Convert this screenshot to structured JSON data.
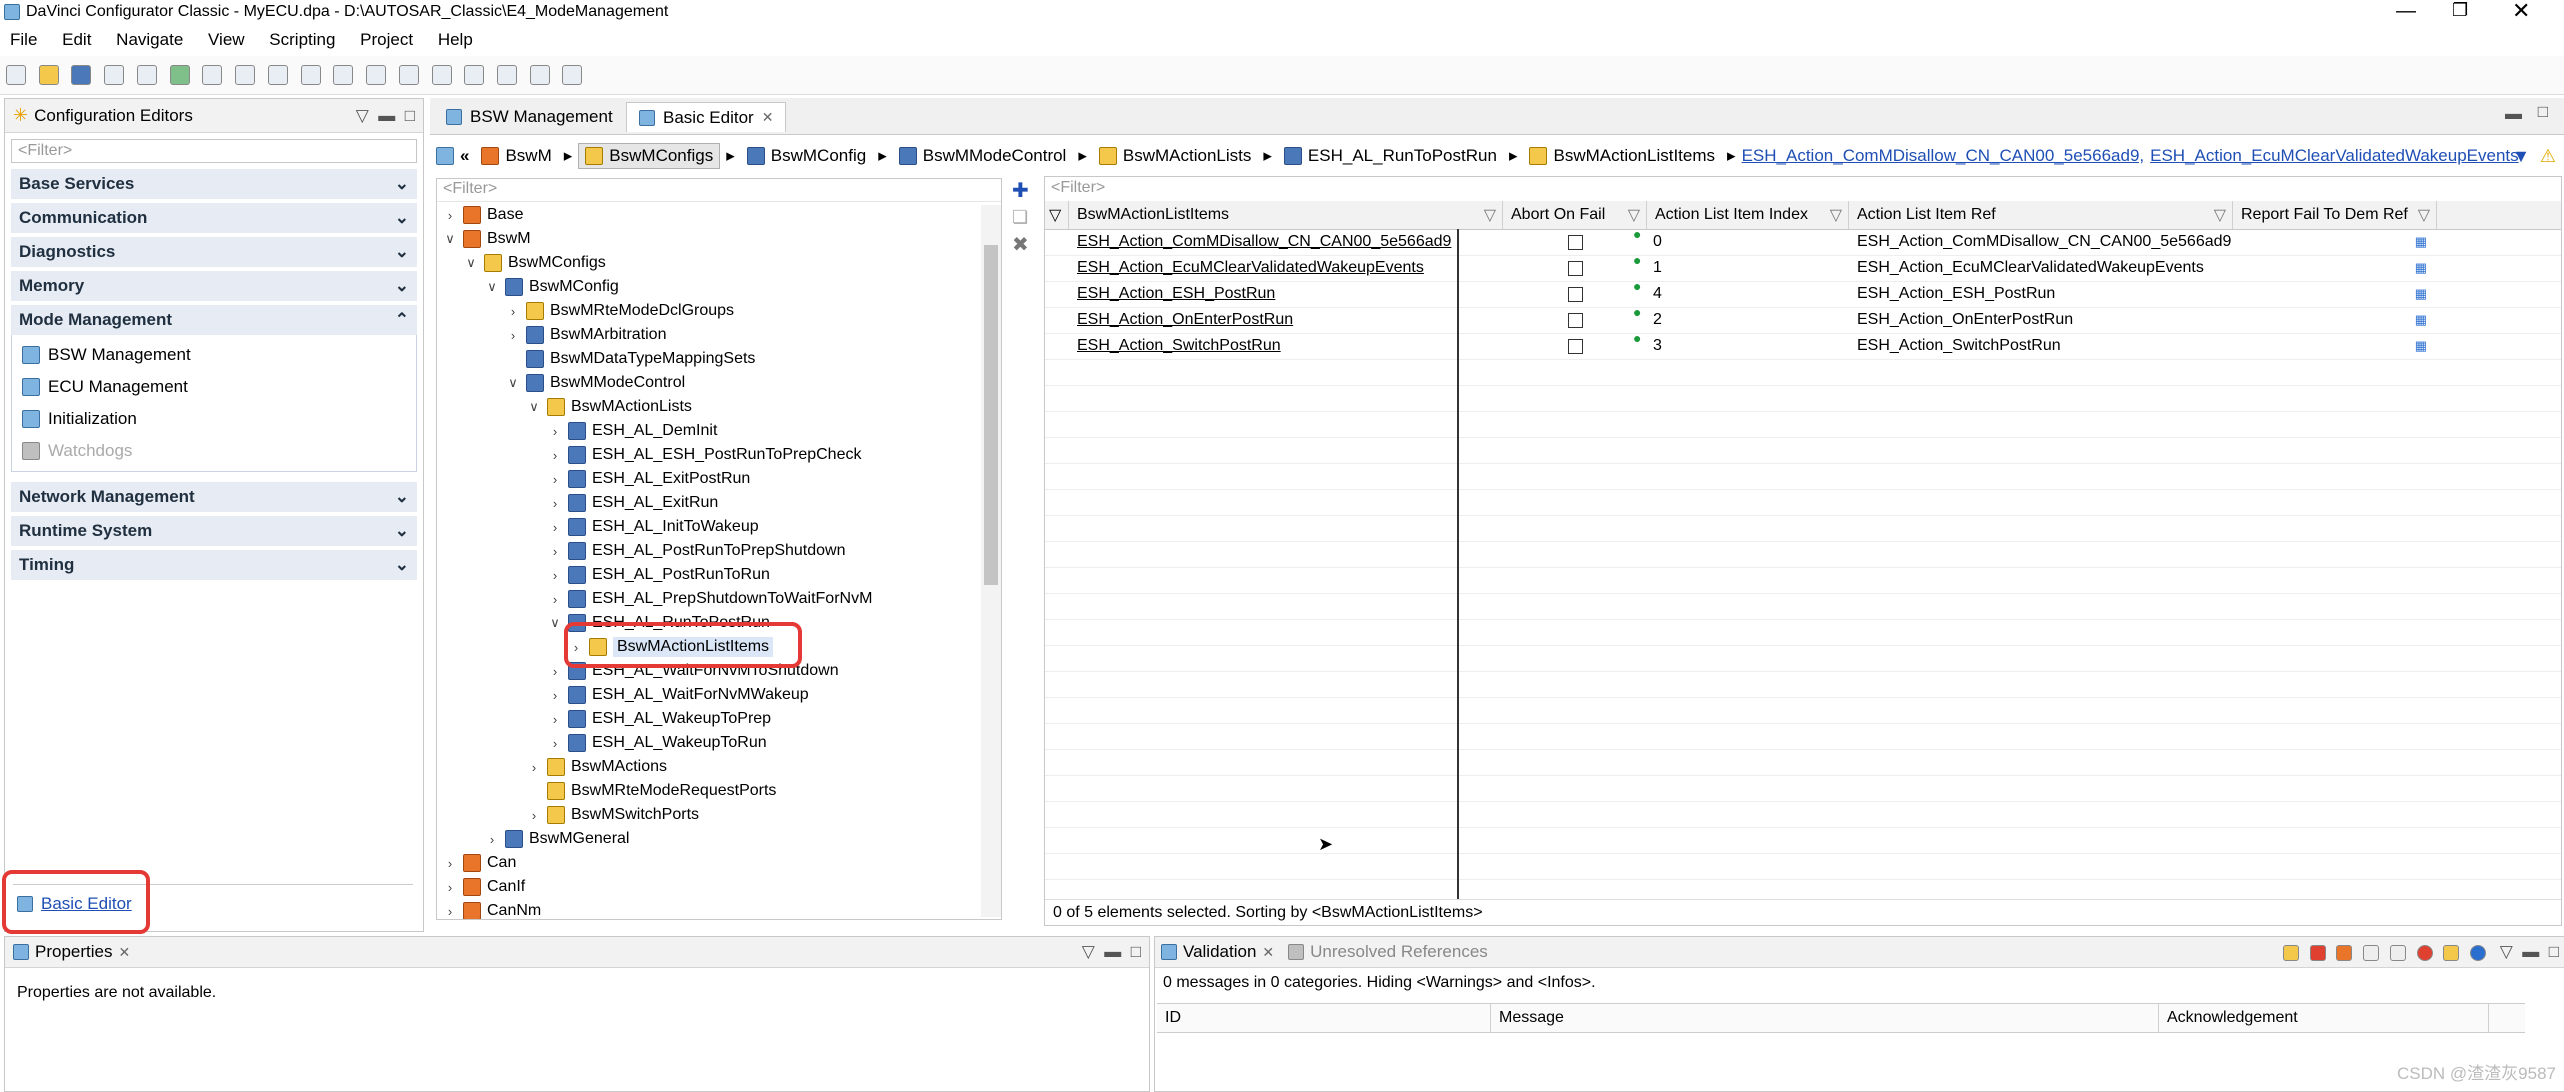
{
  "window": {
    "title": "DaVinci Configurator Classic - MyECU.dpa - D:\\AUTOSAR_Classic\\E4_ModeManagement"
  },
  "menu": [
    "File",
    "Edit",
    "Navigate",
    "View",
    "Scripting",
    "Project",
    "Help"
  ],
  "left_pane": {
    "title": "Configuration Editors",
    "filter_placeholder": "<Filter>",
    "categories": [
      {
        "label": "Base Services"
      },
      {
        "label": "Communication"
      },
      {
        "label": "Diagnostics"
      },
      {
        "label": "Memory"
      },
      {
        "label": "Mode Management",
        "expanded": true,
        "items": [
          {
            "label": "BSW Management",
            "icon": "bsw-management-icon"
          },
          {
            "label": "ECU Management",
            "icon": "ecu-management-icon"
          },
          {
            "label": "Initialization",
            "icon": "initialization-icon"
          },
          {
            "label": "Watchdogs",
            "icon": "watchdogs-icon",
            "disabled": true
          }
        ]
      },
      {
        "label": "Network Management"
      },
      {
        "label": "Runtime System"
      },
      {
        "label": "Timing"
      }
    ],
    "basic_editor_link": "Basic Editor"
  },
  "editor_tabs": [
    {
      "label": "BSW Management",
      "active": false
    },
    {
      "label": "Basic Editor",
      "active": true
    }
  ],
  "breadcrumb": {
    "items": [
      "BswM",
      "BswMConfigs",
      "BswMConfig",
      "BswMModeControl",
      "BswMActionLists",
      "ESH_AL_RunToPostRun",
      "BswMActionListItems"
    ],
    "selected_index": 1,
    "links": [
      "ESH_Action_ComMDisallow_CN_CAN00_5e566ad9,",
      "ESH_Action_EcuMClearValidatedWakeupEvents"
    ]
  },
  "tree": {
    "filter_placeholder": "<Filter>",
    "nodes": [
      {
        "label": "Base",
        "level": 0,
        "arrow": ">",
        "icon": "o"
      },
      {
        "label": "BswM",
        "level": 0,
        "arrow": "v",
        "icon": "o"
      },
      {
        "label": "BswMConfigs",
        "level": 1,
        "arrow": "v",
        "icon": "y"
      },
      {
        "label": "BswMConfig",
        "level": 2,
        "arrow": "v",
        "icon": "b"
      },
      {
        "label": "BswMRteModeDclGroups",
        "level": 3,
        "arrow": ">",
        "icon": "y"
      },
      {
        "label": "BswMArbitration",
        "level": 3,
        "arrow": ">",
        "icon": "b"
      },
      {
        "label": "BswMDataTypeMappingSets",
        "level": 3,
        "arrow": "",
        "icon": "b"
      },
      {
        "label": "BswMModeControl",
        "level": 3,
        "arrow": "v",
        "icon": "b"
      },
      {
        "label": "BswMActionLists",
        "level": 4,
        "arrow": "v",
        "icon": "y"
      },
      {
        "label": "ESH_AL_DemInit",
        "level": 5,
        "arrow": ">",
        "icon": "b"
      },
      {
        "label": "ESH_AL_ESH_PostRunToPrepCheck",
        "level": 5,
        "arrow": ">",
        "icon": "b"
      },
      {
        "label": "ESH_AL_ExitPostRun",
        "level": 5,
        "arrow": ">",
        "icon": "b"
      },
      {
        "label": "ESH_AL_ExitRun",
        "level": 5,
        "arrow": ">",
        "icon": "b"
      },
      {
        "label": "ESH_AL_InitToWakeup",
        "level": 5,
        "arrow": ">",
        "icon": "b"
      },
      {
        "label": "ESH_AL_PostRunToPrepShutdown",
        "level": 5,
        "arrow": ">",
        "icon": "b"
      },
      {
        "label": "ESH_AL_PostRunToRun",
        "level": 5,
        "arrow": ">",
        "icon": "b"
      },
      {
        "label": "ESH_AL_PrepShutdownToWaitForNvM",
        "level": 5,
        "arrow": ">",
        "icon": "b"
      },
      {
        "label": "ESH_AL_RunToPostRun",
        "level": 5,
        "arrow": "v",
        "icon": "b"
      },
      {
        "label": "BswMActionListItems",
        "level": 6,
        "arrow": ">",
        "icon": "y",
        "selected": true
      },
      {
        "label": "ESH_AL_WaitForNvMToShutdown",
        "level": 5,
        "arrow": ">",
        "icon": "b"
      },
      {
        "label": "ESH_AL_WaitForNvMWakeup",
        "level": 5,
        "arrow": ">",
        "icon": "b"
      },
      {
        "label": "ESH_AL_WakeupToPrep",
        "level": 5,
        "arrow": ">",
        "icon": "b"
      },
      {
        "label": "ESH_AL_WakeupToRun",
        "level": 5,
        "arrow": ">",
        "icon": "b"
      },
      {
        "label": "BswMActions",
        "level": 4,
        "arrow": ">",
        "icon": "y"
      },
      {
        "label": "BswMRteModeRequestPorts",
        "level": 4,
        "arrow": "",
        "icon": "y"
      },
      {
        "label": "BswMSwitchPorts",
        "level": 4,
        "arrow": ">",
        "icon": "y"
      },
      {
        "label": "BswMGeneral",
        "level": 2,
        "arrow": ">",
        "icon": "b"
      },
      {
        "label": "Can",
        "level": 0,
        "arrow": ">",
        "icon": "o"
      },
      {
        "label": "CanIf",
        "level": 0,
        "arrow": ">",
        "icon": "o"
      },
      {
        "label": "CanNm",
        "level": 0,
        "arrow": ">",
        "icon": "o"
      }
    ]
  },
  "table": {
    "filter_placeholder": "<Filter>",
    "columns": [
      "BswMActionListItems",
      "Abort On Fail",
      "Action List Item Index",
      "Action List Item Ref",
      "Report Fail To Dem Ref"
    ],
    "rows": [
      {
        "name": "ESH_Action_ComMDisallow_CN_CAN00_5e566ad9",
        "abort": false,
        "index": "0",
        "ref": "ESH_Action_ComMDisallow_CN_CAN00_5e566ad9"
      },
      {
        "name": "ESH_Action_EcuMClearValidatedWakeupEvents",
        "abort": false,
        "index": "1",
        "ref": "ESH_Action_EcuMClearValidatedWakeupEvents"
      },
      {
        "name": "ESH_Action_ESH_PostRun",
        "abort": false,
        "index": "4",
        "ref": "ESH_Action_ESH_PostRun"
      },
      {
        "name": "ESH_Action_OnEnterPostRun",
        "abort": false,
        "index": "2",
        "ref": "ESH_Action_OnEnterPostRun"
      },
      {
        "name": "ESH_Action_SwitchPostRun",
        "abort": false,
        "index": "3",
        "ref": "ESH_Action_SwitchPostRun"
      }
    ],
    "status": "0 of 5 elements selected. Sorting by <BswMActionListItems>"
  },
  "properties": {
    "title": "Properties",
    "message": "Properties are not available."
  },
  "validation": {
    "tab_validation": "Validation",
    "tab_unresolved": "Unresolved References",
    "summary": "0 messages in 0 categories. Hiding <Warnings> and <Infos>.",
    "columns": [
      "ID",
      "Message",
      "Acknowledgement"
    ]
  },
  "watermark": "CSDN @渣渣灰9587"
}
